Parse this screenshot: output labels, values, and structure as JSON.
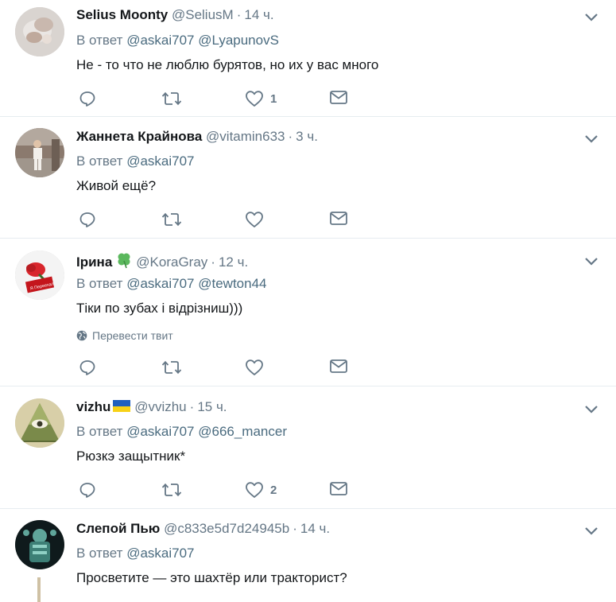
{
  "labels": {
    "reply_prefix": "В ответ",
    "translate": "Перевести твит"
  },
  "colors": {
    "text": "#14171a",
    "muted": "#657786",
    "mention": "#4a6b7f",
    "divider": "#e6ecf0",
    "clover": "#5bb85d",
    "flag_blue": "#1f5fbf",
    "flag_yellow": "#f7d117"
  },
  "icons": {
    "reply": "reply-icon",
    "retweet": "retweet-icon",
    "like": "heart-icon",
    "dm": "envelope-icon",
    "menu": "chevron-down-icon",
    "globe": "globe-icon"
  },
  "tweets": [
    {
      "name": "Selius Moonty",
      "handle": "@SeliusM",
      "time": "14 ч.",
      "mentions": [
        "@askai707",
        "@LyapunovS"
      ],
      "text": "Не - то что не люблю бурятов, но их у вас много",
      "likes": "1"
    },
    {
      "name": "Жаннета Крайнова",
      "handle": "@vitamin633",
      "time": "3 ч.",
      "mentions": [
        "@askai707"
      ],
      "text": "Живой ещё?",
      "likes": ""
    },
    {
      "name": "Ірина",
      "handle": "@KoraGray",
      "time": "12 ч.",
      "mentions": [
        "@askai707",
        "@tewton44"
      ],
      "text": "Тіки по зубах і відрізниш)))",
      "likes": "",
      "avatar_sign": "Я Переехал"
    },
    {
      "name": "vizhu",
      "handle": "@vvizhu",
      "time": "15 ч.",
      "mentions": [
        "@askai707",
        "@666_mancer"
      ],
      "text": "Рюзкэ защытник*",
      "likes": "2"
    },
    {
      "name": "Слепой Пью",
      "handle": "@c833e5d7d24945b",
      "time": "14 ч.",
      "mentions": [
        "@askai707"
      ],
      "text": "Просветите — это шахтёр или тракторист?",
      "likes": ""
    }
  ]
}
